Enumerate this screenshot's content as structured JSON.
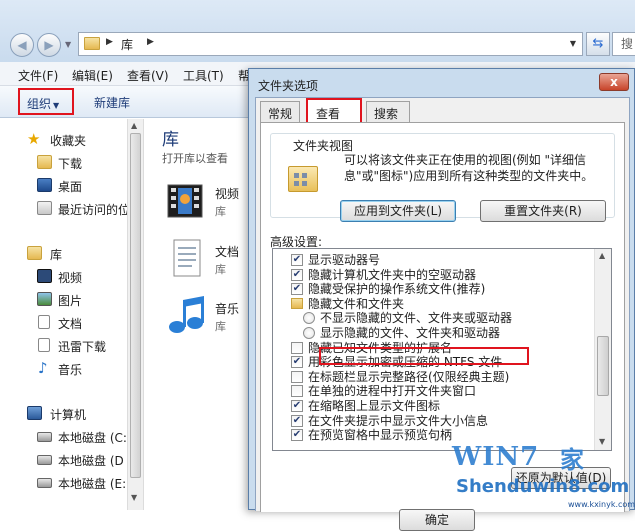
{
  "explorer": {
    "address": {
      "path": "库",
      "search_placeholder": "搜"
    },
    "menu": [
      "文件(F)",
      "编辑(E)",
      "查看(V)",
      "工具(T)",
      "帮"
    ],
    "toolbar": {
      "organize": "组织",
      "new_library": "新建库"
    },
    "nav": {
      "favorites": {
        "label": "收藏夹",
        "items": [
          "下载",
          "桌面",
          "最近访问的位"
        ]
      },
      "libraries": {
        "label": "库",
        "items": [
          "视频",
          "图片",
          "文档",
          "迅雷下载",
          "音乐"
        ]
      },
      "computer": {
        "label": "计算机",
        "items": [
          "本地磁盘 (C:",
          "本地磁盘 (D",
          "本地磁盘 (E:"
        ]
      }
    },
    "content": {
      "title": "库",
      "subtitle": "打开库以查看",
      "libraries": [
        {
          "name": "视频",
          "type": "库"
        },
        {
          "name": "文档",
          "type": "库"
        },
        {
          "name": "音乐",
          "type": "库"
        }
      ]
    }
  },
  "dialog": {
    "title": "文件夹选项",
    "close": "x",
    "tabs": [
      "常规",
      "查看",
      "搜索"
    ],
    "folder_views": {
      "label": "文件夹视图",
      "description": "可以将该文件夹正在使用的视图(例如 \"详细信息\"或\"图标\")应用到所有这种类型的文件夹中。",
      "apply_button": "应用到文件夹(L)",
      "reset_button": "重置文件夹(R)"
    },
    "advanced_label": "高级设置:",
    "advanced_items": [
      {
        "kind": "checkbox",
        "checked": true,
        "indent": 1,
        "text": "显示驱动器号"
      },
      {
        "kind": "checkbox",
        "checked": true,
        "indent": 1,
        "text": "隐藏计算机文件夹中的空驱动器"
      },
      {
        "kind": "checkbox",
        "checked": true,
        "indent": 1,
        "text": "隐藏受保护的操作系统文件(推荐)"
      },
      {
        "kind": "folder",
        "checked": false,
        "indent": 1,
        "text": "隐藏文件和文件夹"
      },
      {
        "kind": "radio",
        "checked": false,
        "indent": 2,
        "text": "不显示隐藏的文件、文件夹或驱动器"
      },
      {
        "kind": "radio",
        "checked": false,
        "indent": 2,
        "text": "显示隐藏的文件、文件夹和驱动器"
      },
      {
        "kind": "checkbox",
        "checked": false,
        "indent": 1,
        "text": "隐藏已知文件类型的扩展名"
      },
      {
        "kind": "checkbox",
        "checked": true,
        "indent": 1,
        "text": "用彩色显示加密或压缩的 NTFS 文件"
      },
      {
        "kind": "checkbox",
        "checked": false,
        "indent": 1,
        "text": "在标题栏显示完整路径(仅限经典主题)"
      },
      {
        "kind": "checkbox",
        "checked": false,
        "indent": 1,
        "text": "在单独的进程中打开文件夹窗口"
      },
      {
        "kind": "checkbox",
        "checked": true,
        "indent": 1,
        "text": "在缩略图上显示文件图标"
      },
      {
        "kind": "checkbox",
        "checked": true,
        "indent": 1,
        "text": "在文件夹提示中显示文件大小信息"
      },
      {
        "kind": "checkbox",
        "checked": true,
        "indent": 1,
        "text": "在预览窗格中显示预览句柄"
      }
    ],
    "restore_button": "还原为默认值(D)",
    "ok_button": "确定"
  },
  "watermark": {
    "logo": "WIN7",
    "jia": "家",
    "domain": "Shenduwin8.com",
    "small": "www.kxinyk.com"
  }
}
